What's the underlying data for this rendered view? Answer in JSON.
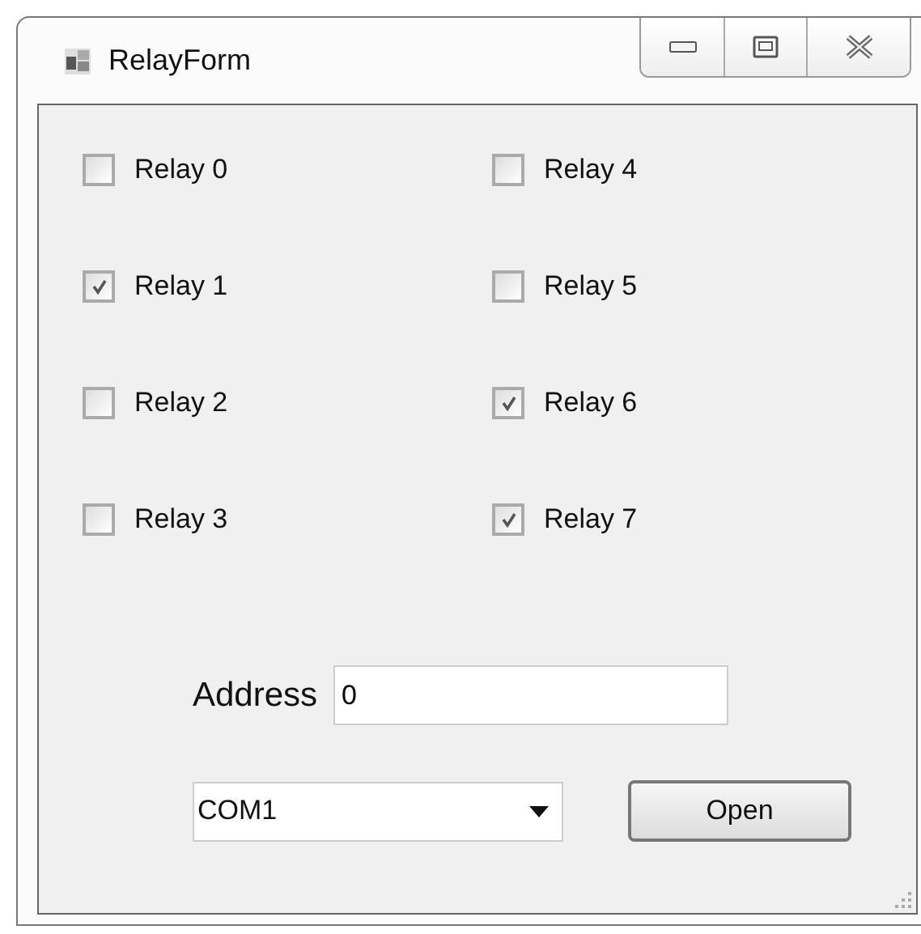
{
  "window": {
    "title": "RelayForm"
  },
  "relays": [
    {
      "label": "Relay 0",
      "checked": false
    },
    {
      "label": "Relay 1",
      "checked": true
    },
    {
      "label": "Relay 2",
      "checked": false
    },
    {
      "label": "Relay 3",
      "checked": false
    },
    {
      "label": "Relay 4",
      "checked": false
    },
    {
      "label": "Relay 5",
      "checked": false
    },
    {
      "label": "Relay 6",
      "checked": true
    },
    {
      "label": "Relay 7",
      "checked": true
    }
  ],
  "address": {
    "label": "Address",
    "value": "0"
  },
  "port": {
    "value": "COM1"
  },
  "open_button": {
    "label": "Open"
  }
}
